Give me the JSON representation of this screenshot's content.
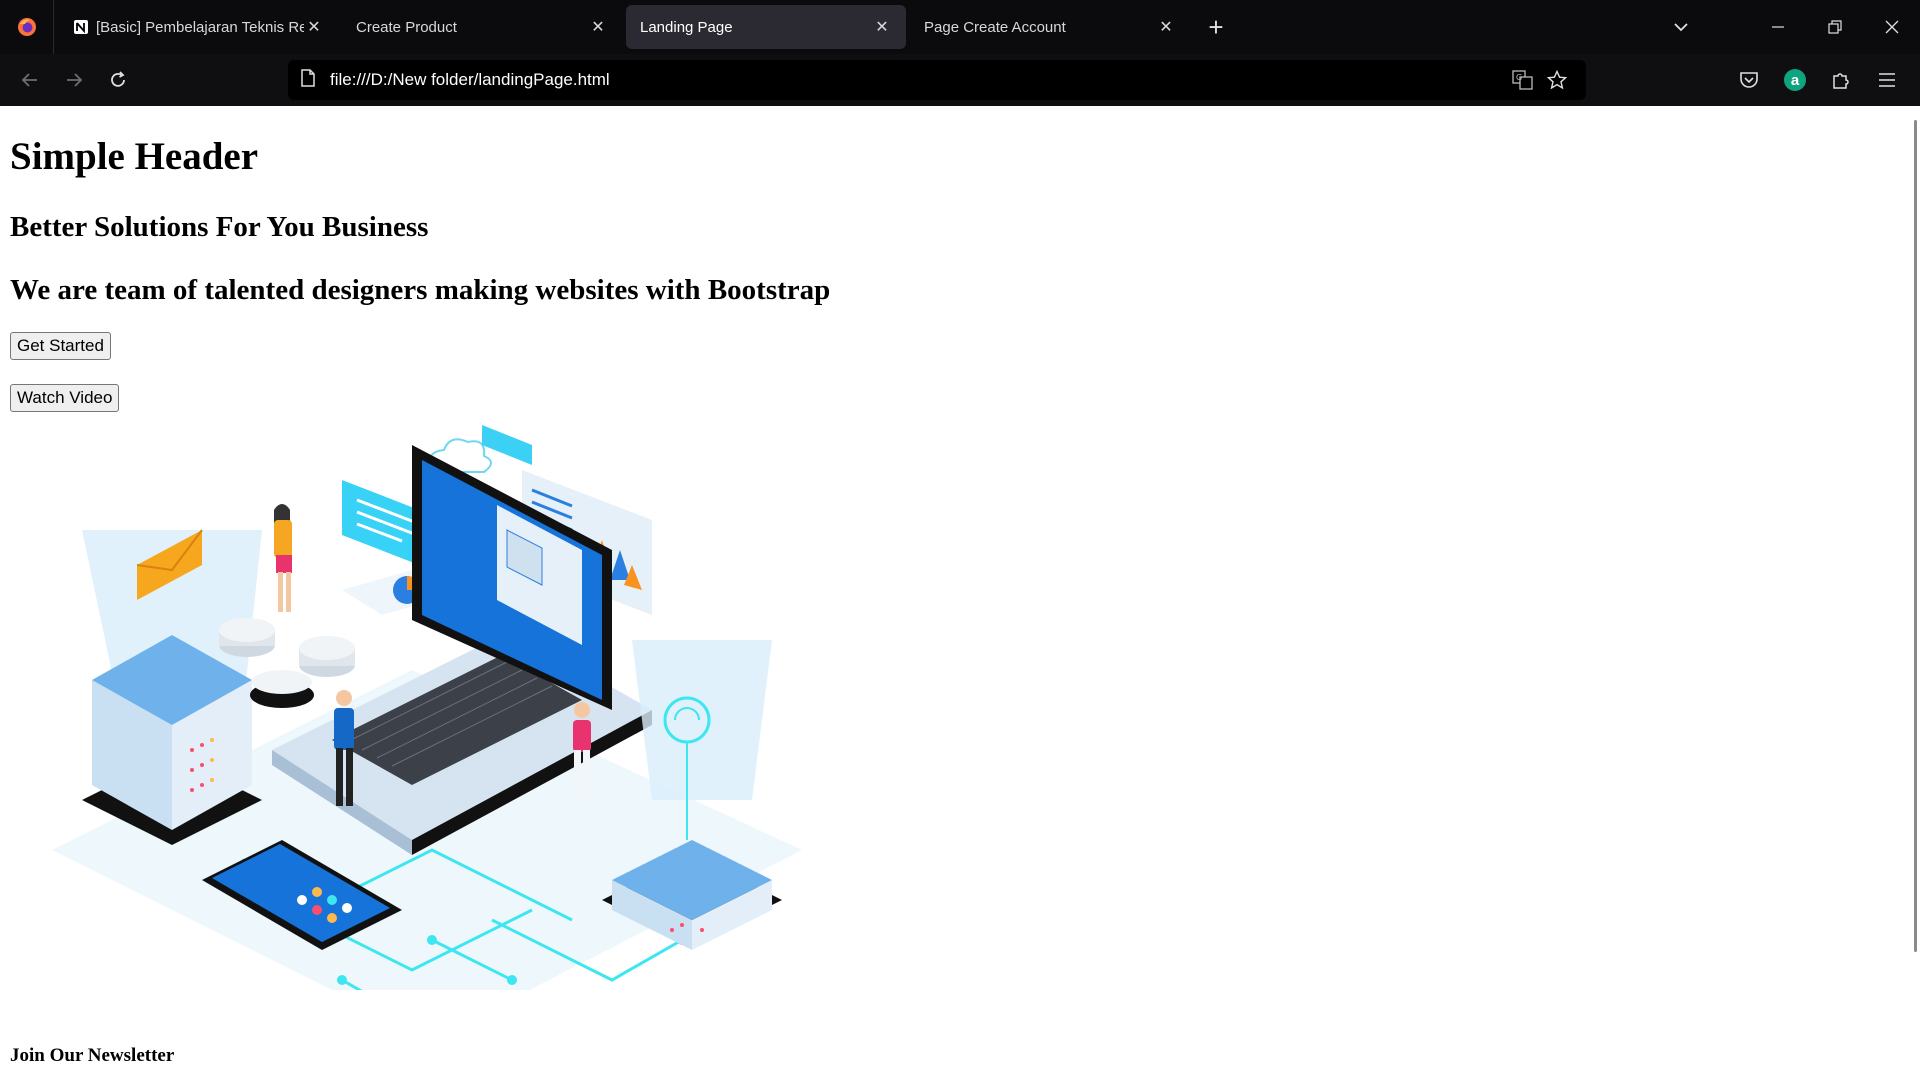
{
  "browser": {
    "tabs": [
      {
        "label": "[Basic] Pembelajaran Teknis Re",
        "icon": "notion-icon",
        "active": false
      },
      {
        "label": "Create Product",
        "icon": "",
        "active": false
      },
      {
        "label": "Landing Page",
        "icon": "",
        "active": true
      },
      {
        "label": "Page Create Account",
        "icon": "",
        "active": false
      }
    ],
    "url": "file:///D:/New folder/landingPage.html",
    "account_initial": "a",
    "colors": {
      "accent_account": "#10a37f",
      "active_tab": "#2b2a33"
    }
  },
  "page": {
    "title": "Simple Header",
    "subtitle": "Better Solutions For You Business",
    "tagline": "We are team of talented designers making websites with Bootstrap",
    "get_started": "Get Started",
    "watch_video": "Watch Video",
    "newsletter_heading": "Join Our Newsletter"
  }
}
